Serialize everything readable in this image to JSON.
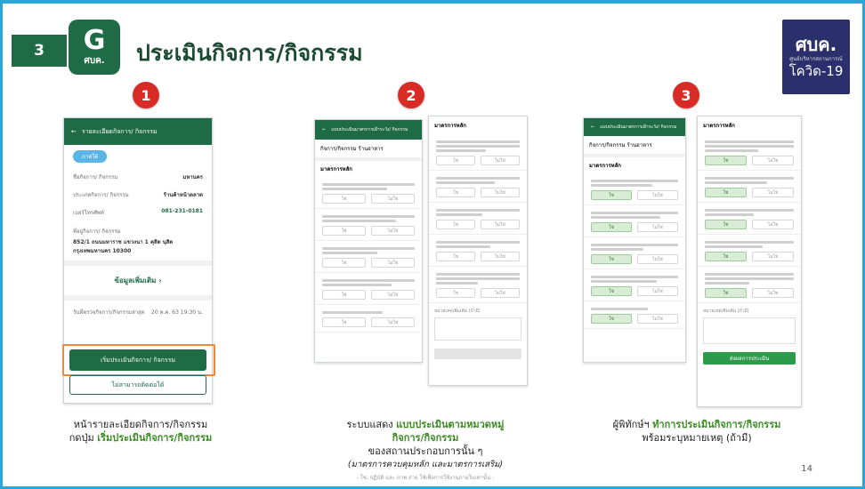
{
  "header": {
    "step": "3",
    "logo_letter": "G",
    "logo_text": "ศบค.",
    "title": "ประเมินกิจการ/กิจกรรม"
  },
  "brand": {
    "line1": "ศบค.",
    "line2": "ศูนย์บริหารสถานการณ์",
    "line3": "โควิด-19"
  },
  "badges": [
    "1",
    "2",
    "3"
  ],
  "screen1": {
    "bar_title": "รายละเอียดกิจการ/ กิจกรรม",
    "chip": "ภาคใต้",
    "rows": [
      [
        "ชื่อกิจการ/ กิจกรรม",
        "มหานคร"
      ],
      [
        "ประเภทกิจการ/ กิจกรรม",
        "ร้านค้าหน้าตลาด"
      ],
      [
        "เบอร์โทรศัพท์",
        "081-231-0181"
      ]
    ],
    "address_label": "ที่อยู่กิจการ/ กิจกรรม",
    "address": "852/1 ถนนมหาราช แขวงนา 1 คุสิต นุสิต กรุงเทพมหานคร 10300",
    "more_label": "ข้อมูลเพิ่มเติม",
    "last_label": "วันที่ตรวจกิจการ/กิจกรรมล่าสุด",
    "last_value": "20 พ.ค. 63 19:30 น.",
    "start_button": "เริ่มประเมินกิจการ/ กิจกรรม",
    "cannot_button": "ไม่สามารถติดต่อได้"
  },
  "screen2": {
    "bar_title": "แบบประเมินมาตรการเฝ้าระวัง/ กิจกรรม",
    "subtitle": "กิจการ/กิจกรรม ร้านอาหาร",
    "section": "มาตรการหลัก",
    "yes": "ใช่",
    "no": "ไม่ใช่",
    "note_label": "หมายเหตุเพิ่มเติม (ถ้ามี)"
  },
  "screen3": {
    "bar_title": "แบบประเมินมาตรการเฝ้าระวัง/ กิจกรรม",
    "subtitle": "กิจการ/กิจกรรม ร้านอาหาร",
    "section": "มาตรการหลัก",
    "yes": "ใช่",
    "no": "ไม่ใช่",
    "note_label": "หมายเหตุเพิ่มเติม (ถ้ามี)",
    "submit": "ส่งผลการประเมิน"
  },
  "captions": {
    "c1_line1": "หน้ารายละเอียดกิจการ/กิจกรรม",
    "c1_line2a": "กดปุ่ม ",
    "c1_line2b": "เริ่มประเมินกิจการ/กิจกรรม",
    "c2_line1a": "ระบบแสดง ",
    "c2_line1b": "แบบประเมินตามหมวดหมู่",
    "c2_line2": "กิจการ/กิจกรรม",
    "c2_line3": "ของสถานประกอบการนั้น ๆ",
    "c2_line4": "(มาตรการควบคุมหลัก และมาตรการเสริม)",
    "c2_line5": "- ใช่, ปฏิบัติ  และ  ภาพ ถ่าย  ใช้เพื่อการใช้งานภายในเท่านั้น -",
    "c3_line1a": "ผู้พิทักษ์ฯ ",
    "c3_line1b": "ทำการประเมินกิจการ/กิจกรรม",
    "c3_line2": "พร้อมระบุหมายเหตุ (ถ้ามี)"
  },
  "page_number": "14",
  "colors": {
    "border": "#2aa7d9",
    "brand_green": "#1f6b45",
    "badge_red": "#d92b26",
    "caption_green": "#3a8b24",
    "highlight_orange": "#f0883a"
  }
}
